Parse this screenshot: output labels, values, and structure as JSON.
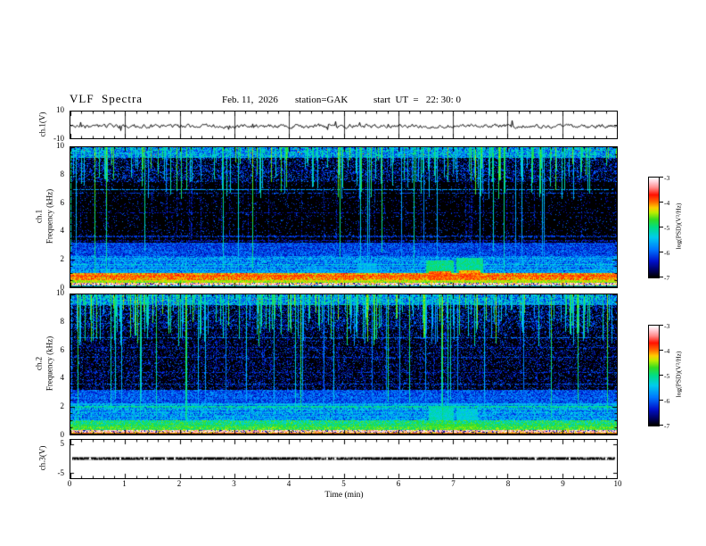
{
  "header": {
    "title": "VLF  Spectra",
    "date": "Feb. 11,  2026",
    "station": "station=GAK",
    "start_ut": "start  UT  =   22: 30: 0"
  },
  "axes": {
    "time": {
      "label": "Time  (min)",
      "ticks": [
        "0",
        "1",
        "2",
        "3",
        "4",
        "5",
        "6",
        "7",
        "8",
        "9",
        "10"
      ],
      "minor_per_major": 5
    }
  },
  "panels": {
    "ch1wave": {
      "ylabel": "ch.1(V)",
      "yticks": [
        "10",
        "-10"
      ]
    },
    "ch1spec": {
      "ylabel_ch": "ch.1",
      "ylabel_freq": "Frequency  (kHz)",
      "yticks": [
        "10",
        "8",
        "6",
        "4",
        "2",
        "0"
      ]
    },
    "ch2spec": {
      "ylabel_ch": "ch.2",
      "ylabel_freq": "Frequency  (kHz)",
      "yticks": [
        "10",
        "8",
        "6",
        "4",
        "2",
        "0"
      ]
    },
    "ch3wave": {
      "ylabel": "ch.3(V)",
      "yticks": [
        "5",
        "-5"
      ]
    }
  },
  "colorbar": {
    "label": "log(PSD)(V²/Hz)",
    "ticks": [
      "-3",
      "-4",
      "-5",
      "-6",
      "-7"
    ],
    "range": [
      -7,
      -3
    ],
    "stops": [
      [
        0,
        "#000000"
      ],
      [
        0.06,
        "#000055"
      ],
      [
        0.16,
        "#0011cc"
      ],
      [
        0.28,
        "#0077ff"
      ],
      [
        0.4,
        "#00ccee"
      ],
      [
        0.5,
        "#00dd88"
      ],
      [
        0.58,
        "#33dd22"
      ],
      [
        0.65,
        "#bbee00"
      ],
      [
        0.7,
        "#ffcc00"
      ],
      [
        0.76,
        "#ff6600"
      ],
      [
        0.83,
        "#ff1100"
      ],
      [
        0.9,
        "#ff8888"
      ],
      [
        0.96,
        "#ffd0d8"
      ],
      [
        1,
        "#ffffff"
      ]
    ]
  },
  "chart_data": [
    {
      "id": "ch1_waveform",
      "type": "line",
      "title": "ch.1 voltage waveform",
      "xlabel": "Time (min)",
      "xlim": [
        0,
        10
      ],
      "ylabel": "ch.1(V)",
      "ylim": [
        -10,
        10
      ],
      "color": "#000000",
      "grid": "vertical-major",
      "signal": {
        "mean_v": -1,
        "noise_amp_v": 2.4,
        "spike_prob": 0.018,
        "seed": 3
      }
    },
    {
      "id": "ch1_spectrogram",
      "type": "heatmap",
      "title": "ch.1 VLF spectrogram",
      "xlabel": "Time (min)",
      "xlim": [
        0,
        10
      ],
      "ylabel": "Frequency (kHz)",
      "ylim": [
        0,
        10
      ],
      "value_label": "log(PSD)(V²/Hz)",
      "value_range": [
        -7,
        -3
      ],
      "seed": 7,
      "bands": [
        {
          "f": [
            9.25,
            10.0
          ],
          "base": -6.4,
          "rand": 1.45,
          "note": "dense blue/cyan hiss at top"
        },
        {
          "f": [
            7.5,
            9.25
          ],
          "base": -6.7,
          "speckle_p": 0.4
        },
        {
          "f": [
            3.2,
            7.5
          ],
          "base": -6.85,
          "speckle_p": 0.1,
          "note": "mostly black"
        },
        {
          "f": [
            2.2,
            3.2
          ],
          "base": -6.55,
          "rand": 0.85
        },
        {
          "f": [
            1.0,
            2.2
          ],
          "base": -6.35,
          "rand": 1.05
        },
        {
          "f": [
            0.45,
            1.0
          ],
          "base": -4.55,
          "rand": 0.95,
          "note": "intense orange/red band"
        },
        {
          "f": [
            0.32,
            0.45
          ],
          "base": -4.9,
          "rand": 0.8
        },
        {
          "f": [
            0.12,
            0.32
          ],
          "base": -3.45,
          "rand": 0.5,
          "dark_speck_p": 0.3,
          "note": "pale band with dark-red blocks"
        },
        {
          "f": [
            0.0,
            0.12
          ],
          "base": -5.5,
          "rand": 0.4,
          "note": "cyan bottom line"
        }
      ],
      "streaks": {
        "prob": 0.27,
        "deep_prob": 0.15,
        "value": [
          -5.6,
          -4.5
        ],
        "note": "vertical sferic streaks from 10 kHz downward"
      },
      "lines": [
        [
          8.35,
          -6.3,
          0.5
        ],
        [
          7.0,
          -5.7,
          0.2
        ],
        [
          6.75,
          -6.1,
          0.5
        ],
        [
          5.3,
          -6.35,
          0.6
        ],
        [
          3.62,
          -6.15,
          0.4
        ],
        [
          3.3,
          -6.35,
          0.5
        ],
        [
          2.5,
          -6.0,
          0.45
        ],
        [
          2.05,
          -5.5,
          0.3
        ],
        [
          1.9,
          -5.7,
          0.35
        ],
        [
          1.62,
          -5.3,
          0.25
        ],
        [
          1.45,
          -5.75,
          0.35
        ],
        [
          1.22,
          -5.4,
          0.3
        ],
        [
          1.05,
          -5.6,
          0.3
        ],
        [
          0.85,
          -4.1,
          0
        ],
        [
          0.75,
          -3.85,
          0
        ],
        [
          0.62,
          -4.05,
          0
        ],
        [
          0.52,
          -4.35,
          0
        ],
        [
          0.42,
          -4.5,
          0
        ],
        [
          0.3,
          -4.7,
          0.15
        ]
      ],
      "blobs": [
        [
          6.5,
          7.0,
          0.35,
          1.9,
          -5.0
        ],
        [
          6.55,
          6.95,
          0.45,
          1.15,
          -3.95
        ],
        [
          7.05,
          7.55,
          0.4,
          2.1,
          -5.05
        ],
        [
          7.1,
          7.5,
          0.5,
          1.2,
          -4.1
        ],
        [
          5.25,
          5.6,
          0.9,
          1.7,
          -5.6
        ],
        [
          4.4,
          4.65,
          0.8,
          1.5,
          -5.9
        ]
      ]
    },
    {
      "id": "ch2_spectrogram",
      "type": "heatmap",
      "title": "ch.2 VLF spectrogram",
      "xlabel": "Time (min)",
      "xlim": [
        0,
        10
      ],
      "ylabel": "Frequency (kHz)",
      "ylim": [
        0,
        10
      ],
      "value_label": "log(PSD)(V²/Hz)",
      "value_range": [
        -7,
        -3
      ],
      "seed": 13,
      "bands": [
        {
          "f": [
            9.25,
            10.0
          ],
          "base": -6.4,
          "rand": 1.45
        },
        {
          "f": [
            7.5,
            9.25
          ],
          "base": -6.7,
          "speckle_p": 0.45
        },
        {
          "f": [
            3.2,
            7.5
          ],
          "base": -6.85,
          "speckle_p": 0.32,
          "note": "noisier blue than ch.1"
        },
        {
          "f": [
            2.2,
            3.2
          ],
          "base": -6.5,
          "rand": 0.9
        },
        {
          "f": [
            1.0,
            2.2
          ],
          "base": -6.3,
          "rand": 1.1
        },
        {
          "f": [
            0.45,
            1.0
          ],
          "base": -5.45,
          "rand": 0.95,
          "note": "green/yellow-green band"
        },
        {
          "f": [
            0.32,
            0.45
          ],
          "base": -5.15,
          "rand": 0.8
        },
        {
          "f": [
            0.12,
            0.32
          ],
          "base": -3.45,
          "rand": 0.5,
          "dark_speck_p": 0.3
        },
        {
          "f": [
            0.0,
            0.12
          ],
          "base": -4.2,
          "rand": 0.3,
          "note": "dark red bottom line"
        }
      ],
      "streaks": {
        "prob": 0.34,
        "deep_prob": 0.18,
        "value": [
          -5.6,
          -4.5
        ]
      },
      "lines": [
        [
          6.9,
          -5.9,
          0.35
        ],
        [
          6.2,
          -6.25,
          0.5
        ],
        [
          5.5,
          -6.15,
          0.45
        ],
        [
          4.4,
          -6.25,
          0.5
        ],
        [
          3.6,
          -6.05,
          0.4
        ],
        [
          3.1,
          -6.2,
          0.45
        ],
        [
          2.6,
          -6.05,
          0.4
        ],
        [
          2.15,
          -5.6,
          0.3
        ],
        [
          1.95,
          -5.05,
          0.15
        ],
        [
          1.8,
          -5.25,
          0.2
        ],
        [
          1.55,
          -5.55,
          0.3
        ],
        [
          1.3,
          -5.6,
          0.3
        ],
        [
          1.1,
          -5.7,
          0.3
        ],
        [
          0.62,
          -4.85,
          0.1
        ],
        [
          0.5,
          -4.65,
          0.1
        ],
        [
          0.4,
          -4.95,
          0.1
        ],
        [
          0.3,
          -5.2,
          0.15
        ]
      ],
      "blobs": [
        [
          6.55,
          7.0,
          0.8,
          1.9,
          -5.25
        ],
        [
          7.05,
          7.45,
          0.85,
          1.75,
          -5.35
        ],
        [
          6.5,
          7.5,
          0.28,
          0.72,
          -4.8
        ],
        [
          5.7,
          5.95,
          1.0,
          1.8,
          -6.0
        ]
      ]
    },
    {
      "id": "ch3_waveform",
      "type": "line",
      "title": "ch.3 voltage waveform (flat)",
      "xlabel": "Time (min)",
      "xlim": [
        0,
        10
      ],
      "ylabel": "ch.3(V)",
      "ylim": [
        -5,
        5
      ],
      "color": "#000000",
      "signal": {
        "constant_v": 0,
        "thickness_v": 0.7,
        "seed": 5
      }
    }
  ]
}
